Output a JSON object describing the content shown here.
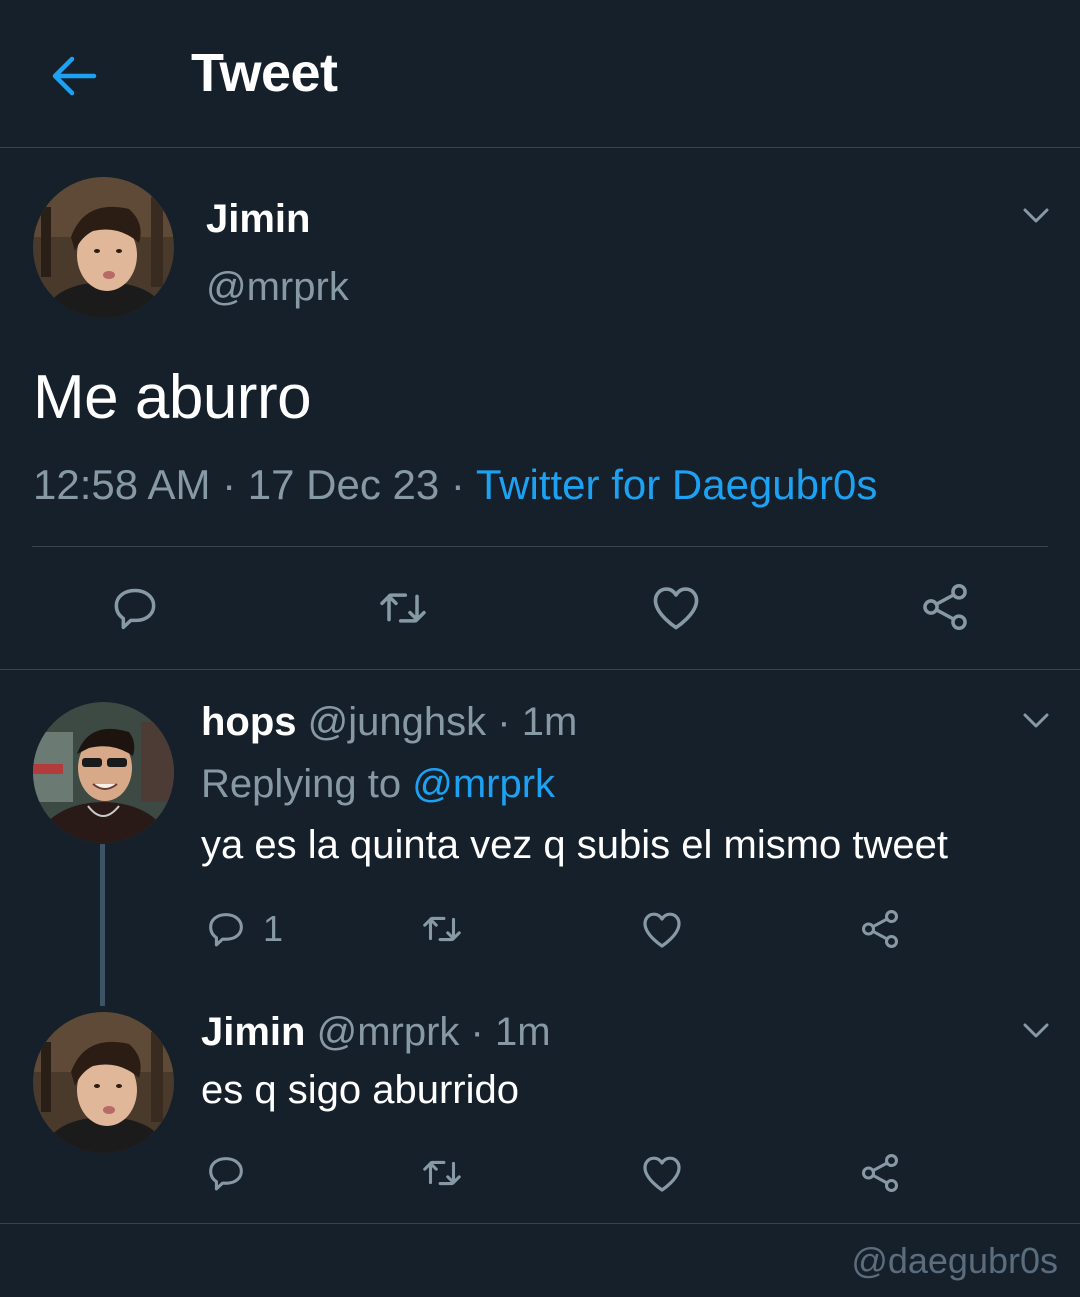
{
  "header": {
    "title": "Tweet",
    "back_icon": "arrow-left-icon"
  },
  "colors": {
    "background": "#15202b",
    "accent": "#1da1f2",
    "muted": "#8899a6",
    "divider": "#38444d"
  },
  "tweet": {
    "author_name": "Jimin",
    "author_handle": "@mrprk",
    "text": "Me aburro",
    "time": "12:58 AM",
    "sep1": " · ",
    "date": "17 Dec 23",
    "sep2": " · ",
    "source": "Twitter for Daegubr0s"
  },
  "replies": [
    {
      "name": "hops",
      "handle": "@junghsk",
      "sep": " · ",
      "age": "1m",
      "replying_prefix": "Replying to ",
      "replying_mention": "@mrprk",
      "text": "ya es la quinta vez q subis el mismo tweet",
      "reply_count": "1"
    },
    {
      "name": "Jimin",
      "handle": "@mrprk",
      "sep": " · ",
      "age": "1m",
      "text": "es q sigo aburrido"
    }
  ],
  "watermark": "@daegubr0s"
}
